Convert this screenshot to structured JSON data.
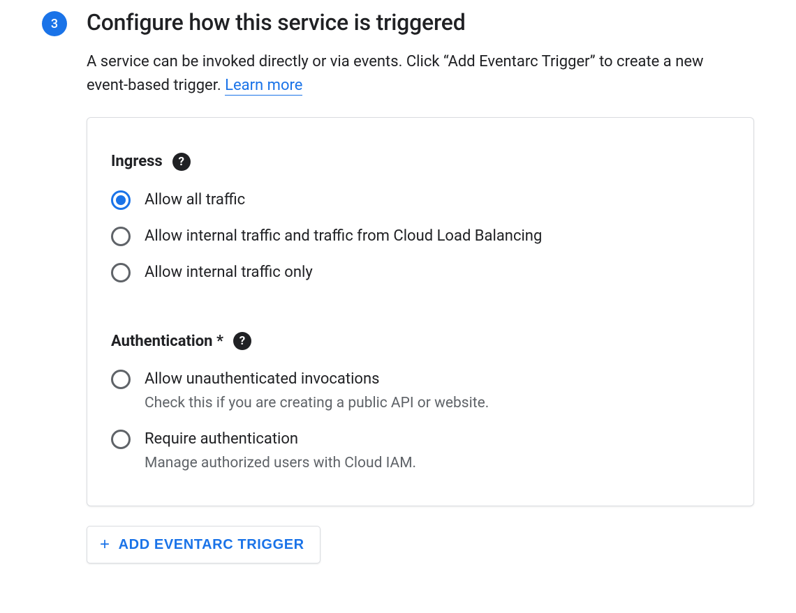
{
  "step": {
    "number": "3",
    "title": "Configure how this service is triggered",
    "description": "A service can be invoked directly or via events. Click “Add Eventarc Trigger” to create a new event-based trigger.",
    "learn_more_label": "Learn more"
  },
  "ingress": {
    "title": "Ingress",
    "options": [
      {
        "label": "Allow all traffic",
        "selected": true
      },
      {
        "label": "Allow internal traffic and traffic from Cloud Load Balancing",
        "selected": false
      },
      {
        "label": "Allow internal traffic only",
        "selected": false
      }
    ]
  },
  "authentication": {
    "title": "Authentication *",
    "options": [
      {
        "label": "Allow unauthenticated invocations",
        "sublabel": "Check this if you are creating a public API or website.",
        "selected": false
      },
      {
        "label": "Require authentication",
        "sublabel": "Manage authorized users with Cloud IAM.",
        "selected": false
      }
    ]
  },
  "add_trigger_button": {
    "label": "ADD EVENTARC TRIGGER"
  }
}
